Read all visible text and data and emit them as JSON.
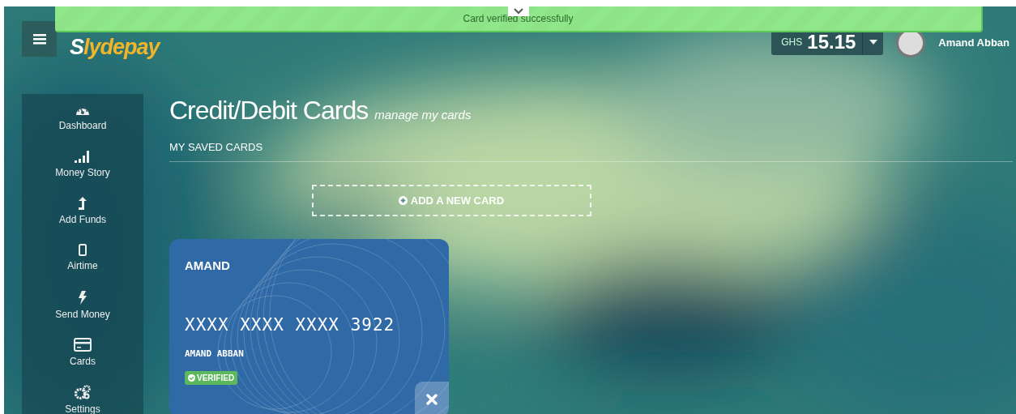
{
  "toast": {
    "message": "Card verified successfully"
  },
  "brand": {
    "logo": "Slydepay"
  },
  "balance": {
    "currency": "GHS",
    "amount": "15.15"
  },
  "user": {
    "name": "Amand Abban"
  },
  "sidebar": {
    "items": [
      {
        "label": "Dashboard"
      },
      {
        "label": "Money Story"
      },
      {
        "label": "Add Funds"
      },
      {
        "label": "Airtime"
      },
      {
        "label": "Send Money"
      },
      {
        "label": "Cards"
      },
      {
        "label": "Settings"
      }
    ]
  },
  "page": {
    "title": "Credit/Debit Cards",
    "subtitle": "manage my cards",
    "section": "MY SAVED CARDS",
    "add_button": "ADD A NEW CARD"
  },
  "cards": [
    {
      "label": "AMAND",
      "number": "XXXX XXXX XXXX 3922",
      "holder": "AMAND ABBAN",
      "verified": true,
      "badge": "VERIFIED"
    }
  ]
}
